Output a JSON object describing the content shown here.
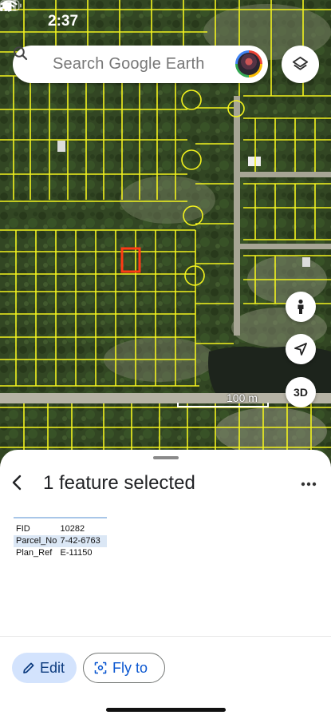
{
  "status_bar": {
    "time": "2:37"
  },
  "search": {
    "placeholder": "Search Google Earth"
  },
  "map": {
    "scale_label": "100 m",
    "view_3d_label": "3D"
  },
  "sheet": {
    "title": "1 feature selected",
    "attributes": [
      {
        "key": "FID",
        "value": "10282",
        "selected": false
      },
      {
        "key": "Parcel_No",
        "value": "7-42-6763",
        "selected": true
      },
      {
        "key": "Plan_Ref",
        "value": "E-11150",
        "selected": false
      }
    ],
    "edit_label": "Edit",
    "fly_to_label": "Fly to"
  },
  "colors": {
    "parcel_lines": "#f2f21e",
    "selected_parcel": "#ff3b14",
    "edit_bg": "#d3e3fd",
    "accent": "#0b57d0"
  },
  "icons": [
    "search-icon",
    "avatar",
    "layers-icon",
    "street-view-icon",
    "location-arrow-icon",
    "back-icon",
    "more-icon",
    "pencil-icon",
    "fly-to-icon"
  ]
}
